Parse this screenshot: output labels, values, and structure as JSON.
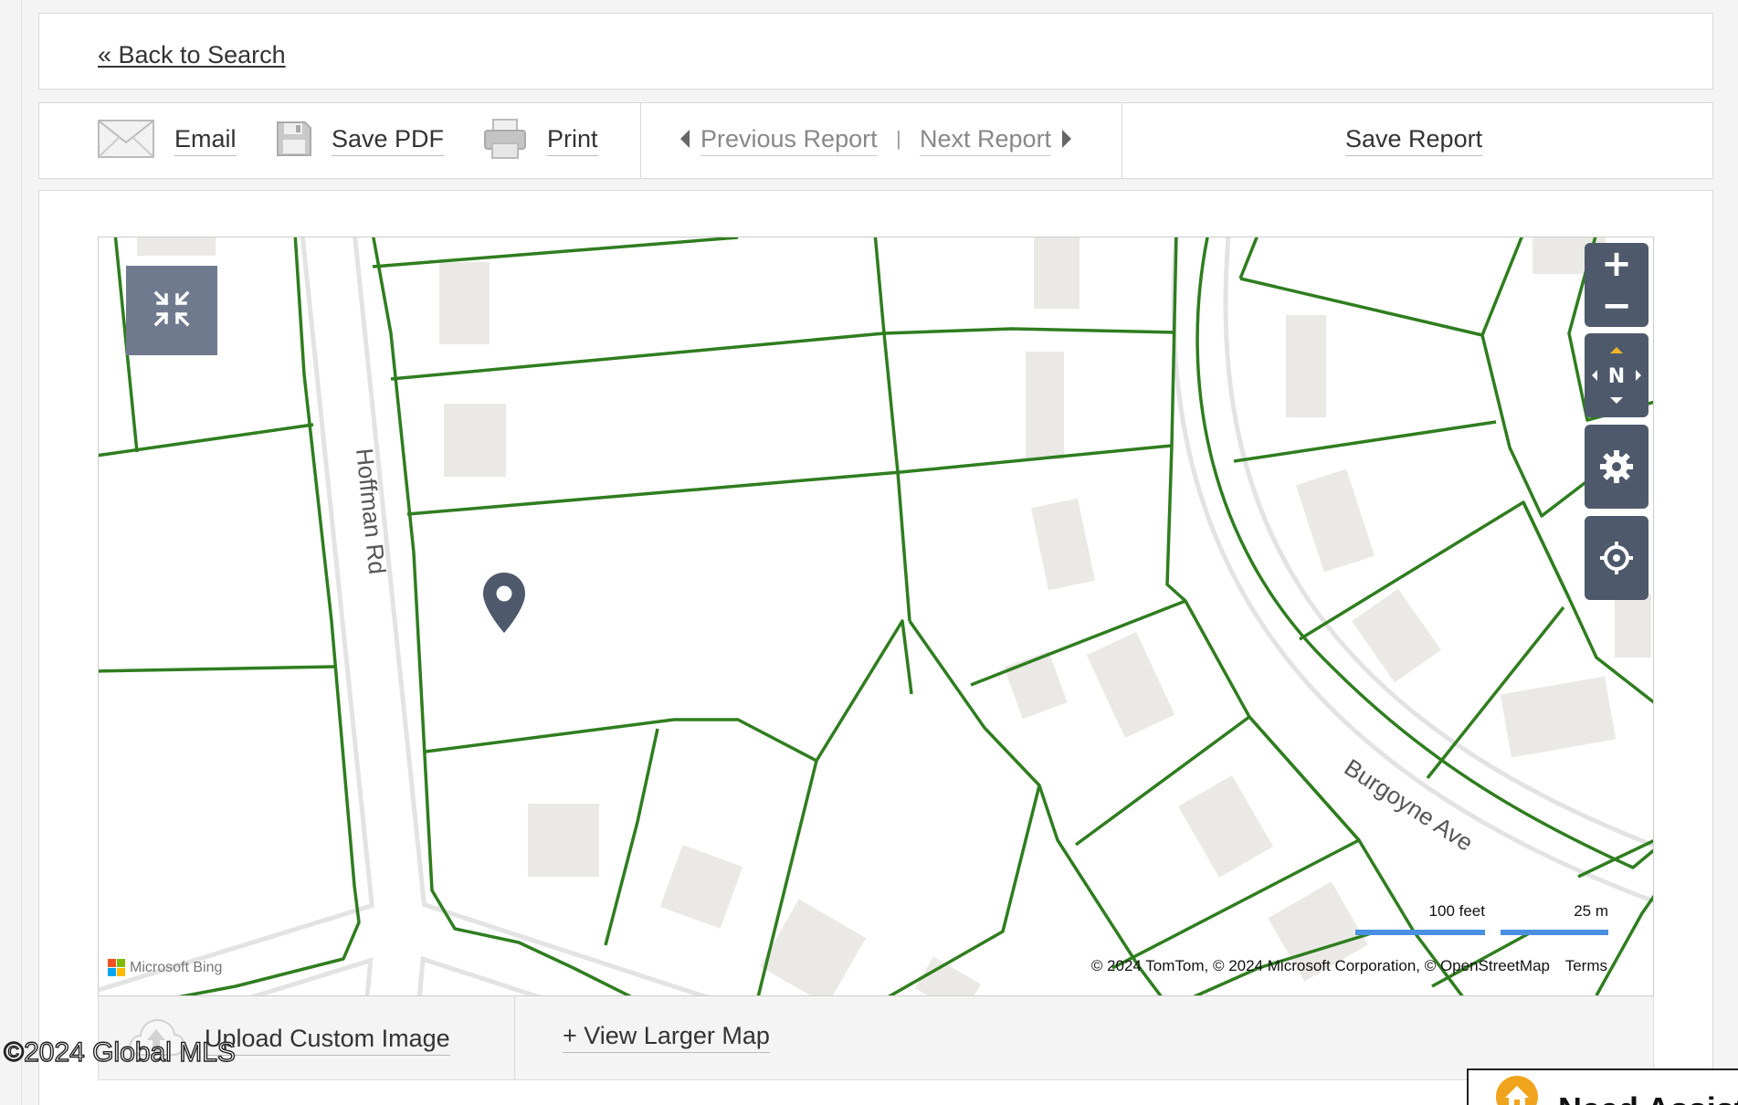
{
  "back": {
    "label": "« Back to Search"
  },
  "toolbar": {
    "email_label": "Email",
    "save_pdf_label": "Save PDF",
    "print_label": "Print",
    "previous_label": "Previous Report",
    "separator": "|",
    "next_label": "Next Report",
    "save_report_label": "Save Report"
  },
  "map": {
    "streets": [
      "Hoffman Rd",
      "Burgoyne Ave"
    ],
    "controls": {
      "zoom_in": "+",
      "zoom_out": "−",
      "compass": "N",
      "icons": [
        "collapse-icon",
        "compass-icon",
        "gear-icon",
        "locate-icon"
      ]
    },
    "scale": {
      "imperial": "100 feet",
      "metric": "25 m"
    },
    "attribution": "© 2024 TomTom, © 2024 Microsoft Corporation, © OpenStreetMap",
    "terms": "Terms",
    "logo": "Microsoft Bing",
    "parcel_line_color": "#2f7d1f",
    "marker_color": "#4e596b"
  },
  "footer": {
    "upload_label": "Upload Custom Image",
    "view_larger_label": "+ View Larger Map"
  },
  "watermark": "©2024 Global MLS",
  "assist": {
    "label": "Need Assist"
  }
}
